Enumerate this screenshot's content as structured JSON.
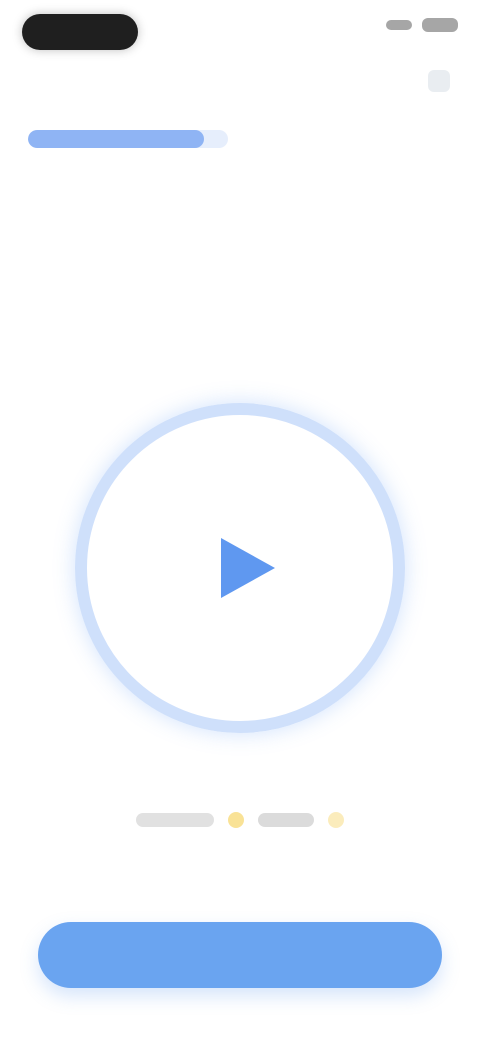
{
  "colors": {
    "accent": "#6aa4f0",
    "accent_soft": "#cfe0fb",
    "progress_fill": "#8fb4f4",
    "progress_track": "#e6eefc",
    "status_pill": "#1f1f1f",
    "indicator_gold": "#f6d56a"
  },
  "status_bar": {
    "icons": [
      "signal-icon",
      "battery-icon"
    ]
  },
  "progress": {
    "value": 0.88
  },
  "prompt": {
    "title_line1": "",
    "title_line2": "",
    "subtitle": ""
  },
  "player": {
    "icon": "play-icon"
  },
  "indicators": {
    "items": [
      "pill",
      "dot",
      "pill",
      "dot"
    ]
  },
  "footer": {
    "primary_label": ""
  }
}
